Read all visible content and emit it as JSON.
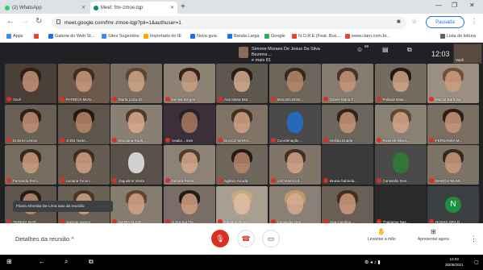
{
  "browser": {
    "tabs": [
      {
        "label": "(2) WhatsApp",
        "color": "#25d366"
      },
      {
        "label": "Meet: fmr-zmoe-tqp",
        "color": "#00897b"
      }
    ],
    "new_tab": "+",
    "url": "meet.google.com/fmr-zmoe-tqp?pli=1&authuser=1",
    "profile_label": "Pausada",
    "bookmarks": [
      {
        "label": "Apps",
        "color": "#4285f4"
      },
      {
        "label": "",
        "color": "#ea4335"
      },
      {
        "label": "Galeria do Web St...",
        "color": "#1a73e8"
      },
      {
        "label": "Sites Sugeridos",
        "color": "#4285f4"
      },
      {
        "label": "Importado do IE",
        "color": "#f9ab00"
      },
      {
        "label": "Nova guia",
        "color": "#1a73e8"
      },
      {
        "label": "Banda Larga",
        "color": "#1a73e8"
      },
      {
        "label": "Google",
        "color": "#34a853"
      },
      {
        "label": "N.O.R.E (Feat. Bus...",
        "color": "#ea4335"
      },
      {
        "label": "www.clarn.com.br...",
        "color": "#ea4335"
      }
    ],
    "reading_list": "Lista de leitura"
  },
  "meet": {
    "presenter_name": "Simone Moraes De Jesus Da Silva Bezerra ...",
    "presenter_more": "e mais 81",
    "participants_count": "99",
    "time": "12:03",
    "self_label": "Você",
    "toast": "Flavia Almeida De Lima saiu da reunião",
    "tiles": [
      {
        "name": "Você",
        "bg": "#4a4038",
        "skin": "#c49378",
        "hair": "#2b1d14"
      },
      {
        "name": "PATRICIA MUN...",
        "bg": "#6b5a4c",
        "skin": "#c99a7c",
        "hair": "#3a2718"
      },
      {
        "name": "Marta Laiza Bl...",
        "bg": "#7a6e62",
        "skin": "#d1a487",
        "hair": "#5a4030"
      },
      {
        "name": "Denise Borges",
        "bg": "#8c8173",
        "skin": "#caa084",
        "hair": "#2a1a10"
      },
      {
        "name": "Ana Maria Mor...",
        "bg": "#5d574d",
        "skin": "#d6ad92",
        "hair": "#1f1812"
      },
      {
        "name": "Manoela Britto...",
        "bg": "#6e6459",
        "skin": "#b9876a",
        "hair": "#2f241a"
      },
      {
        "name": "Gisele Maria F...",
        "bg": "#857b6e",
        "skin": "#c8977a",
        "hair": "#3d2b1e"
      },
      {
        "name": "Poliana Maia ...",
        "bg": "#746a5e",
        "skin": "#d3a688",
        "hair": "#1a120c"
      },
      {
        "name": "Marcia Barbosa",
        "bg": "#9a8f80",
        "skin": "#cf9e80",
        "hair": "#6a4a32"
      },
      {
        "name": "Dolores Lemos",
        "bg": "#6a6156",
        "skin": "#c18f73",
        "hair": "#28190f"
      },
      {
        "name": "Ji 304 Norte...",
        "bg": "#5e564c",
        "skin": "#b98668",
        "hair": "#1d130c"
      },
      {
        "name": "Graciana Rodri...",
        "bg": "#8a7f73",
        "skin": "#d8ab8f",
        "hair": "#4b3322"
      },
      {
        "name": "rosalia ...mes",
        "bg": "#3d2f3a",
        "skin": "#a87a63",
        "hair": "#222"
      },
      {
        "name": "DULCE MARIA ...",
        "bg": "#7f7366",
        "skin": "#cfa286",
        "hair": "#3b2a1c"
      },
      {
        "name": "Coordenação ...",
        "bg": "#4a4a4a",
        "skin": "#1e6fcf",
        "hair": "#4a4a4a"
      },
      {
        "name": "Hellida Duarte",
        "bg": "#6c655c",
        "skin": "#c7957a",
        "hair": "#2a1d14"
      },
      {
        "name": "Rose de Olivei...",
        "bg": "#8a8175",
        "skin": "#d2a58a",
        "hair": "#5c4230"
      },
      {
        "name": "FERNANDA M...",
        "bg": "#7a6e63",
        "skin": "#c9987c",
        "hair": "#221710"
      },
      {
        "name": "Fernanda Ferri...",
        "bg": "#776c60",
        "skin": "#cc9d80",
        "hair": "#2e2016"
      },
      {
        "name": "Luciana Tonon...",
        "bg": "#655b50",
        "skin": "#d0a285",
        "hair": "#3a281a"
      },
      {
        "name": "Jaqueline Vieira",
        "bg": "#5a5148",
        "skin": "#e8e8e8",
        "hair": "#5a5148"
      },
      {
        "name": "Debora Pereir...",
        "bg": "#8d8276",
        "skin": "#d5a98d",
        "hair": "#4a3322"
      },
      {
        "name": "Agilson Arruda",
        "bg": "#6f665b",
        "skin": "#b8876b",
        "hair": "#1a120c"
      },
      {
        "name": "LUCIANA LUI...",
        "bg": "#807568",
        "skin": "#d4a689",
        "hair": "#3a2a1d"
      },
      {
        "name": "Bruna Gabriela...",
        "bg": "#3a3a3a",
        "skin": "#3a3a3a",
        "hair": "#3a3a3a"
      },
      {
        "name": "Comissão Ges...",
        "bg": "#4a4a4a",
        "skin": "#2e7d32",
        "hair": "#4a4a4a"
      },
      {
        "name": "MARCIA MUNI...",
        "bg": "#7d7266",
        "skin": "#c99a7e",
        "hair": "#2e2016"
      },
      {
        "name": "TEREZA MAR...",
        "bg": "#5f574d",
        "skin": "#c08e72",
        "hair": "#221710"
      },
      {
        "name": "graziele gomes",
        "bg": "#6a6157",
        "skin": "#d4a78a",
        "hair": "#4a3020"
      },
      {
        "name": "MARIA ALICE ...",
        "bg": "#877c70",
        "skin": "#d1a386",
        "hair": "#5a3e2a"
      },
      {
        "name": "Ji 114 Sul Pla...",
        "bg": "#7a6c66",
        "skin": "#cf9f83",
        "hair": "#1c130c"
      },
      {
        "name": "Fabiane Almei...",
        "bg": "#a89e92",
        "skin": "#e2bda3",
        "hair": "#c9a878"
      },
      {
        "name": "Comissão Ges...",
        "bg": "#8a8075",
        "skin": "#d6ab8f",
        "hair": "#c29a6a"
      },
      {
        "name": "Ana Carolina ...",
        "bg": "#6a5f54",
        "skin": "#cb9a7c",
        "hair": "#3a2a1a"
      },
      {
        "name": "Thatianna Nas...",
        "bg": "#2a2a2a",
        "skin": "#2a2a2a",
        "hair": "#2a2a2a"
      },
      {
        "name": "NOSSA SRA D...",
        "bg": "#3c4043",
        "skin": "#3c4043",
        "hair": "#3c4043",
        "initial": "N"
      }
    ]
  },
  "controls": {
    "details": "Detalhes da reunião",
    "raise_hand": "Levantar a mão",
    "present": "Apresentar agora"
  },
  "taskbar": {
    "time": "12:03",
    "date": "30/06/2021"
  },
  "colors": {
    "accent": "#1a73e8",
    "danger": "#d93025",
    "meet_bg": "#202124"
  }
}
